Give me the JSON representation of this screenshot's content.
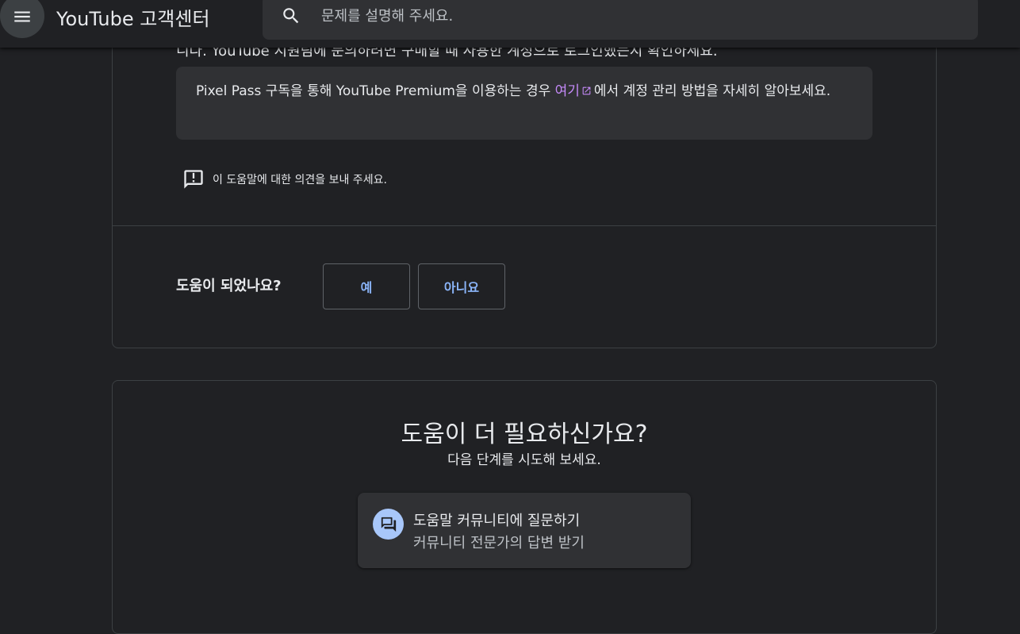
{
  "header": {
    "app_title": "YouTube 고객센터",
    "search_placeholder": "문제를 설명해 주세요."
  },
  "article": {
    "cutoff_text": "니다. YouTube 지원팀에 문의하려면 구매할 때 사용한 계정으로 로그인했는지 확인하세요.",
    "callout": {
      "text_before": "Pixel Pass 구독을 통해 YouTube Premium을 이용하는 경우 ",
      "link_text": "여기",
      "text_after": "에서 계정 관리 방법을 자세히 알아보세요."
    },
    "feedback_label": "이 도움말에 대한 의견을 보내 주세요."
  },
  "helpful": {
    "question": "도움이 되었나요?",
    "yes_label": "예",
    "no_label": "아니요"
  },
  "more_help": {
    "title": "도움이 더 필요하신가요?",
    "subtitle": "다음 단계를 시도해 보세요.",
    "community": {
      "title": "도움말 커뮤니티에 질문하기",
      "subtitle": "커뮤니티 전문가의 답변 받기",
      "icon": "forum-icon"
    }
  },
  "colors": {
    "background": "#202124",
    "surface": "#303134",
    "link": "#c58af9",
    "button_text": "#8ab4f8",
    "icon_circle": "#a8c7fa"
  }
}
